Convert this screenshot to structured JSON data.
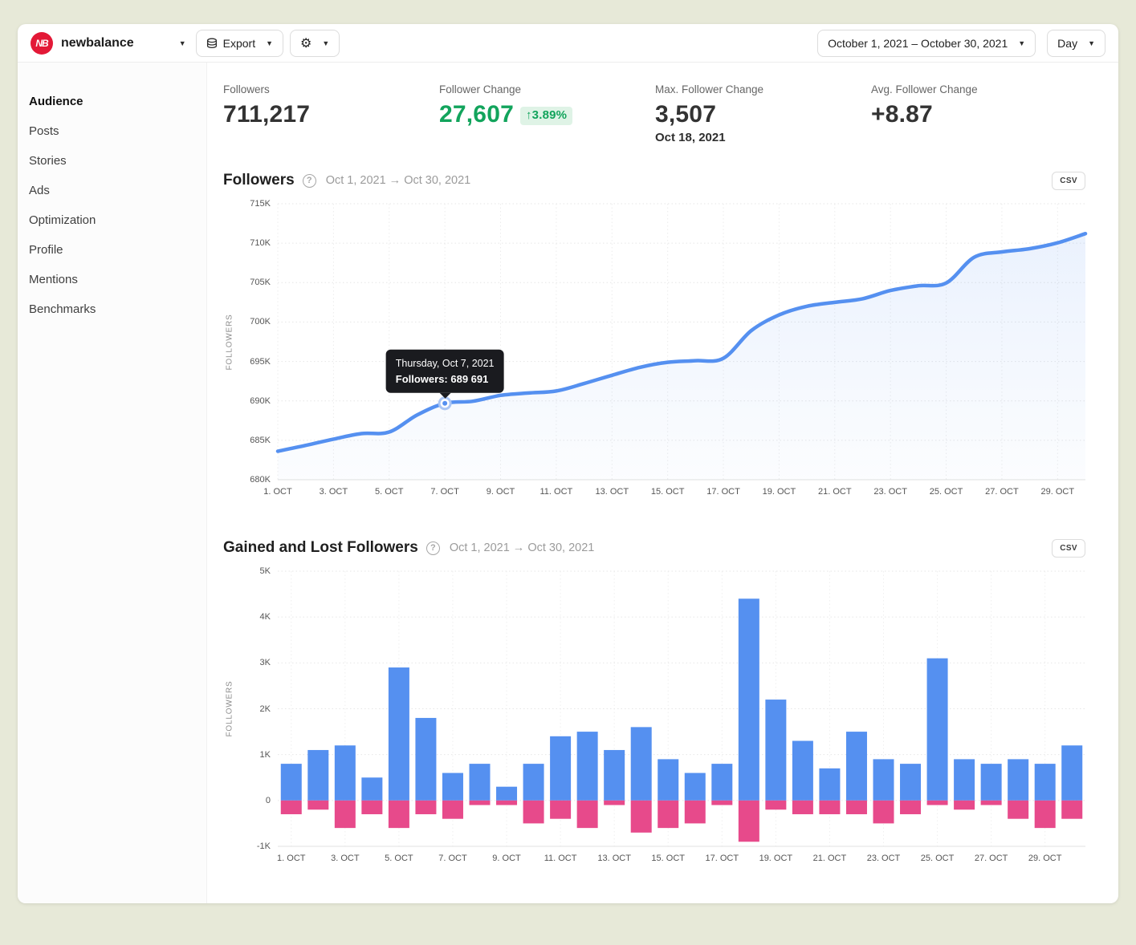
{
  "topbar": {
    "logo_text": "NB",
    "account_name": "newbalance",
    "export_label": "Export",
    "date_range_label": "October 1, 2021 – October 30, 2021",
    "granularity_label": "Day"
  },
  "sidebar": {
    "items": [
      {
        "label": "Audience",
        "active": true
      },
      {
        "label": "Posts"
      },
      {
        "label": "Stories"
      },
      {
        "label": "Ads"
      },
      {
        "label": "Optimization"
      },
      {
        "label": "Profile"
      },
      {
        "label": "Mentions"
      },
      {
        "label": "Benchmarks"
      }
    ]
  },
  "stats": [
    {
      "label": "Followers",
      "value": "711,217"
    },
    {
      "label": "Follower Change",
      "value": "27,607",
      "badge": "↑3.89%"
    },
    {
      "label": "Max. Follower Change",
      "value": "3,507",
      "sub": "Oct 18, 2021"
    },
    {
      "label": "Avg. Follower Change",
      "value": "+8.87"
    }
  ],
  "sections": {
    "followers": {
      "title": "Followers",
      "help": "?",
      "range": "Oct 1, 2021 → Oct 30, 2021",
      "csv_label": "csv"
    },
    "gained_lost": {
      "title": "Gained and Lost Followers",
      "help": "?",
      "range": "Oct 1, 2021 → Oct 30, 2021",
      "csv_label": "csv"
    }
  },
  "tooltip": {
    "line1": "Thursday, Oct 7, 2021",
    "line2": "Followers: 689 691",
    "day_index": 6
  },
  "colors": {
    "accent_blue": "#5590F0",
    "accent_pink": "#E74A8B",
    "positive_green": "#12A45C",
    "badge_bg": "#DFF3E6",
    "logo_red": "#E31937",
    "tooltip_bg": "#1A1B1F",
    "grid": "#E6E6E6"
  },
  "chart_data": [
    {
      "type": "line",
      "title": "Followers",
      "ylabel": "FOLLOWERS",
      "ylim": [
        680000,
        715000
      ],
      "y_tick_step": 5000,
      "y_tick_labels": [
        "680K",
        "685K",
        "690K",
        "695K",
        "700K",
        "705K",
        "710K",
        "715K"
      ],
      "x_tick_labels": [
        "1. OCT",
        "3. OCT",
        "5. OCT",
        "7. OCT",
        "9. OCT",
        "11. OCT",
        "13. OCT",
        "15. OCT",
        "17. OCT",
        "19. OCT",
        "21. OCT",
        "23. OCT",
        "25. OCT",
        "27. OCT",
        "29. OCT"
      ],
      "categories": [
        "Oct 1",
        "Oct 2",
        "Oct 3",
        "Oct 4",
        "Oct 5",
        "Oct 6",
        "Oct 7",
        "Oct 8",
        "Oct 9",
        "Oct 10",
        "Oct 11",
        "Oct 12",
        "Oct 13",
        "Oct 14",
        "Oct 15",
        "Oct 16",
        "Oct 17",
        "Oct 18",
        "Oct 19",
        "Oct 20",
        "Oct 21",
        "Oct 22",
        "Oct 23",
        "Oct 24",
        "Oct 25",
        "Oct 26",
        "Oct 27",
        "Oct 28",
        "Oct 29",
        "Oct 30"
      ],
      "values": [
        683610,
        684350,
        685150,
        685850,
        686050,
        688200,
        689691,
        689950,
        690700,
        691000,
        691250,
        692200,
        693250,
        694250,
        694900,
        695100,
        695400,
        698900,
        700900,
        702000,
        702500,
        702950,
        704000,
        704600,
        704950,
        708200,
        708900,
        709300,
        710050,
        711217
      ],
      "highlight": {
        "index": 6,
        "value": 689691
      },
      "color": "#5590F0",
      "grid": "dotted",
      "legend": "none"
    },
    {
      "type": "bar",
      "title": "Gained and Lost Followers",
      "ylabel": "FOLLOWERS",
      "ylim": [
        -1000,
        5000
      ],
      "y_tick_step": 1000,
      "y_tick_labels": [
        "5K",
        "4K",
        "3K",
        "2K",
        "1K",
        "0",
        "-1K"
      ],
      "x_tick_labels": [
        "1. OCT",
        "3. OCT",
        "5. OCT",
        "7. OCT",
        "9. OCT",
        "11. OCT",
        "13. OCT",
        "15. OCT",
        "17. OCT",
        "19. OCT",
        "21. OCT",
        "23. OCT",
        "25. OCT",
        "27. OCT",
        "29. OCT"
      ],
      "categories": [
        "Oct 1",
        "Oct 2",
        "Oct 3",
        "Oct 4",
        "Oct 5",
        "Oct 6",
        "Oct 7",
        "Oct 8",
        "Oct 9",
        "Oct 10",
        "Oct 11",
        "Oct 12",
        "Oct 13",
        "Oct 14",
        "Oct 15",
        "Oct 16",
        "Oct 17",
        "Oct 18",
        "Oct 19",
        "Oct 20",
        "Oct 21",
        "Oct 22",
        "Oct 23",
        "Oct 24",
        "Oct 25",
        "Oct 26",
        "Oct 27",
        "Oct 28",
        "Oct 29",
        "Oct 30"
      ],
      "series": [
        {
          "name": "Gained",
          "color": "#5590F0",
          "values": [
            800,
            1100,
            1200,
            500,
            2900,
            1800,
            600,
            800,
            300,
            800,
            1400,
            1500,
            1100,
            1600,
            900,
            600,
            800,
            4400,
            2200,
            1300,
            700,
            1500,
            900,
            800,
            3100,
            900,
            800,
            900,
            800,
            1200
          ]
        },
        {
          "name": "Lost",
          "color": "#E74A8B",
          "values": [
            -300,
            -200,
            -600,
            -300,
            -600,
            -300,
            -400,
            -100,
            -100,
            -500,
            -400,
            -600,
            -100,
            -700,
            -600,
            -500,
            -100,
            -900,
            -200,
            -300,
            -300,
            -300,
            -500,
            -300,
            -100,
            -200,
            -100,
            -400,
            -600,
            -400
          ]
        }
      ],
      "grid": "dotted",
      "legend": "none"
    }
  ]
}
